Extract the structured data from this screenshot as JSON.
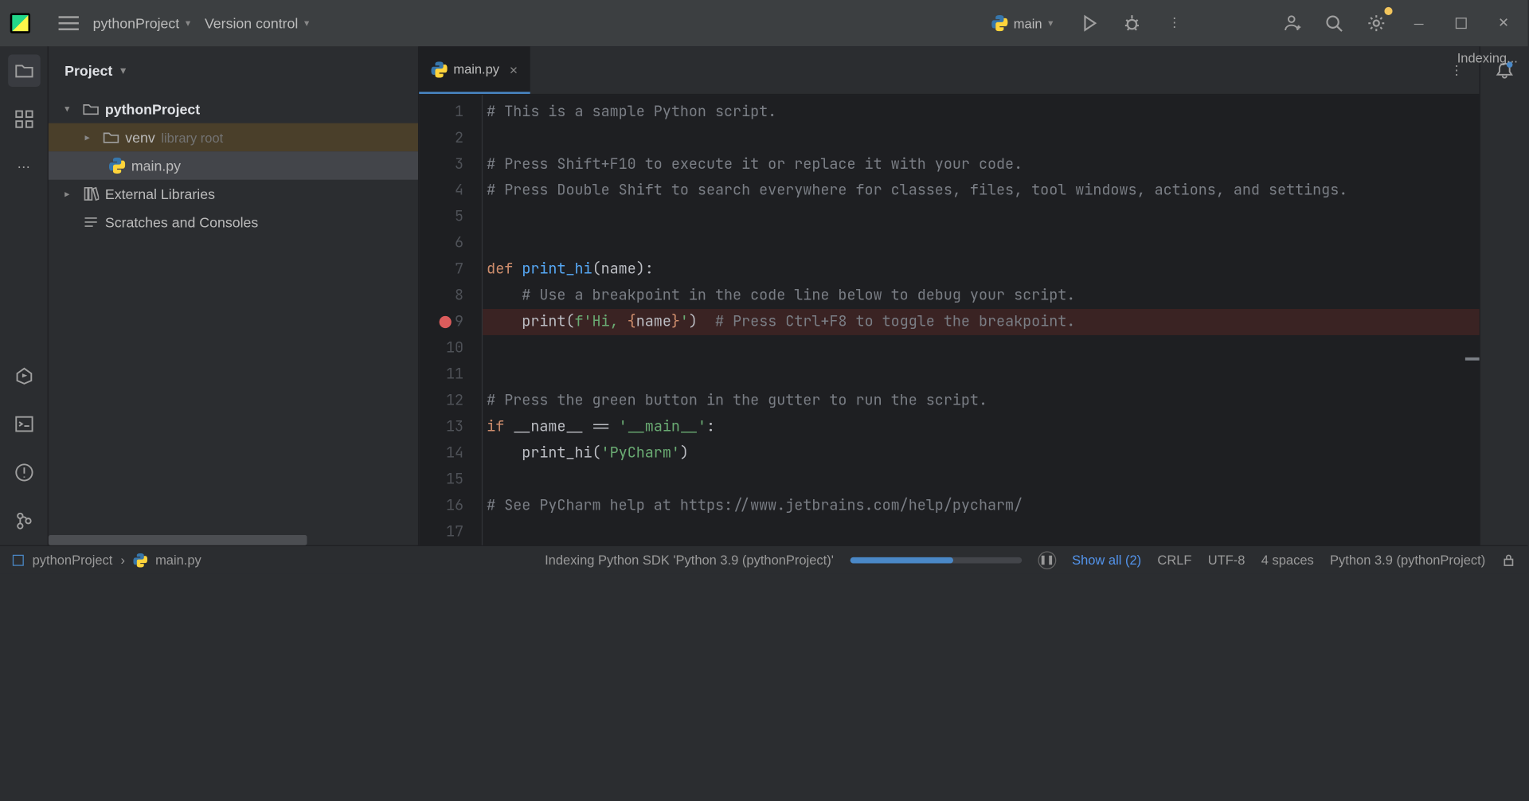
{
  "titlebar": {
    "project_name": "pythonProject",
    "vcs_label": "Version control",
    "run_config": "main"
  },
  "project_panel": {
    "header": "Project",
    "root": "pythonProject",
    "venv": "venv",
    "venv_suffix": "library root",
    "file": "main.py",
    "external": "External Libraries",
    "scratches": "Scratches and Consoles"
  },
  "editor": {
    "tab_name": "main.py",
    "indexing_label": "Indexing...",
    "lines": {
      "l1": "# This is a sample Python script.",
      "l3": "# Press Shift+F10 to execute it or replace it with your code.",
      "l4": "# Press Double Shift to search everywhere for classes, files, tool windows, actions, and settings.",
      "l7_def": "def ",
      "l7_name": "print_hi",
      "l7_rest": "(name):",
      "l8": "    # Use a breakpoint in the code line below to debug your script.",
      "l9_pre": "    print(",
      "l9_f": "f'Hi, ",
      "l9_brace_open": "{",
      "l9_var": "name",
      "l9_brace_close": "}",
      "l9_end": "'",
      "l9_paren": ")",
      "l9_comment": "  # Press Ctrl+F8 to toggle the breakpoint.",
      "l12": "# Press the green button in the gutter to run the script.",
      "l13_if": "if ",
      "l13_name": "__name__ ",
      "l13_eq": "== ",
      "l13_str": "'__main__'",
      "l13_colon": ":",
      "l14_pre": "    print_hi(",
      "l14_str": "'PyCharm'",
      "l14_end": ")",
      "l16": "# See PyCharm help at https://www.jetbrains.com/help/pycharm/"
    }
  },
  "statusbar": {
    "crumb1": "pythonProject",
    "crumb2": "main.py",
    "indexing": "Indexing Python SDK 'Python 3.9 (pythonProject)'",
    "show_all": "Show all (2)",
    "line_sep": "CRLF",
    "encoding": "UTF-8",
    "indent": "4 spaces",
    "interpreter": "Python 3.9 (pythonProject)"
  }
}
